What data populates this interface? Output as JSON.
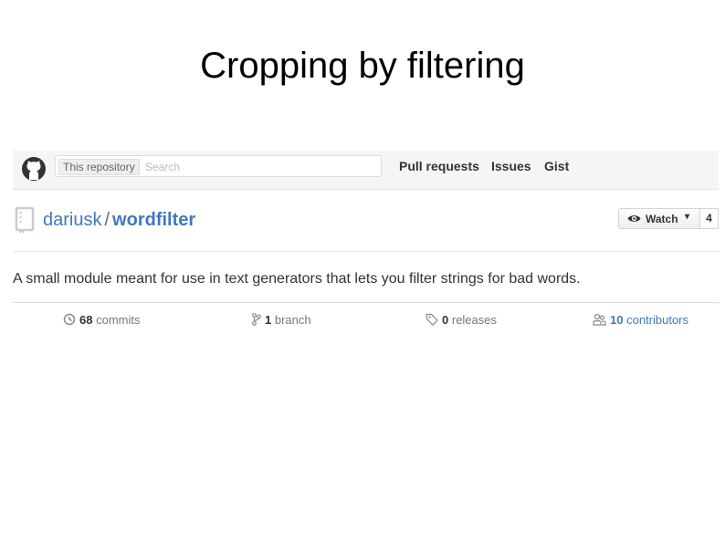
{
  "slide": {
    "title": "Cropping by filtering"
  },
  "header": {
    "logo_icon": "github-octocat-icon",
    "search_scope": "This repository",
    "search_placeholder": "Search",
    "nav": {
      "pull_requests": "Pull requests",
      "issues": "Issues",
      "gist": "Gist"
    }
  },
  "repo": {
    "icon": "repo-book-icon",
    "owner": "dariusk",
    "separator": "/",
    "name": "wordfilter",
    "watch_label": "Watch",
    "watch_count": "4",
    "description": "A small module meant for use in text generators that lets you filter strings for bad words."
  },
  "stats": {
    "commits": {
      "count": "68",
      "label": "commits"
    },
    "branches": {
      "count": "1",
      "label": "branch"
    },
    "releases": {
      "count": "0",
      "label": "releases"
    },
    "contributors": {
      "count": "10",
      "label": "contributors"
    }
  },
  "colors": {
    "link": "#4078c0",
    "header_bg": "#f5f5f5"
  }
}
